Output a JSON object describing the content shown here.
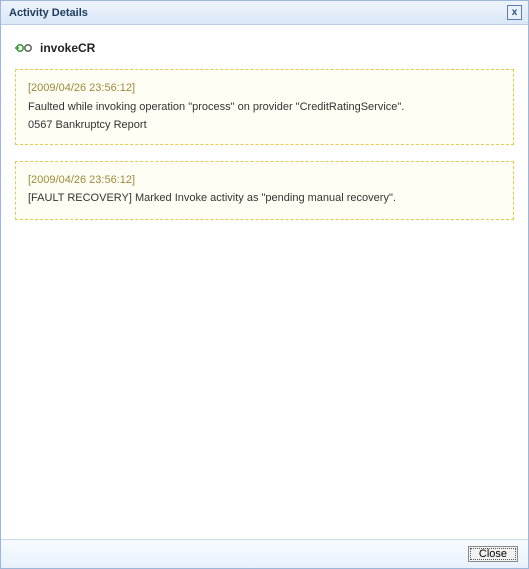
{
  "dialog": {
    "title": "Activity Details",
    "close_icon_label": "x"
  },
  "activity": {
    "icon_name": "invoke-icon",
    "name": "invokeCR"
  },
  "entries": [
    {
      "timestamp": "[2009/04/26 23:56:12]",
      "message": "Faulted while invoking operation \"process\" on provider \"CreditRatingService\".",
      "detail": "0567 Bankruptcy Report"
    },
    {
      "timestamp": "[2009/04/26 23:56:12]",
      "message": "[FAULT RECOVERY] Marked Invoke activity as \"pending manual recovery\".",
      "detail": ""
    }
  ],
  "footer": {
    "close_label": "Close"
  }
}
